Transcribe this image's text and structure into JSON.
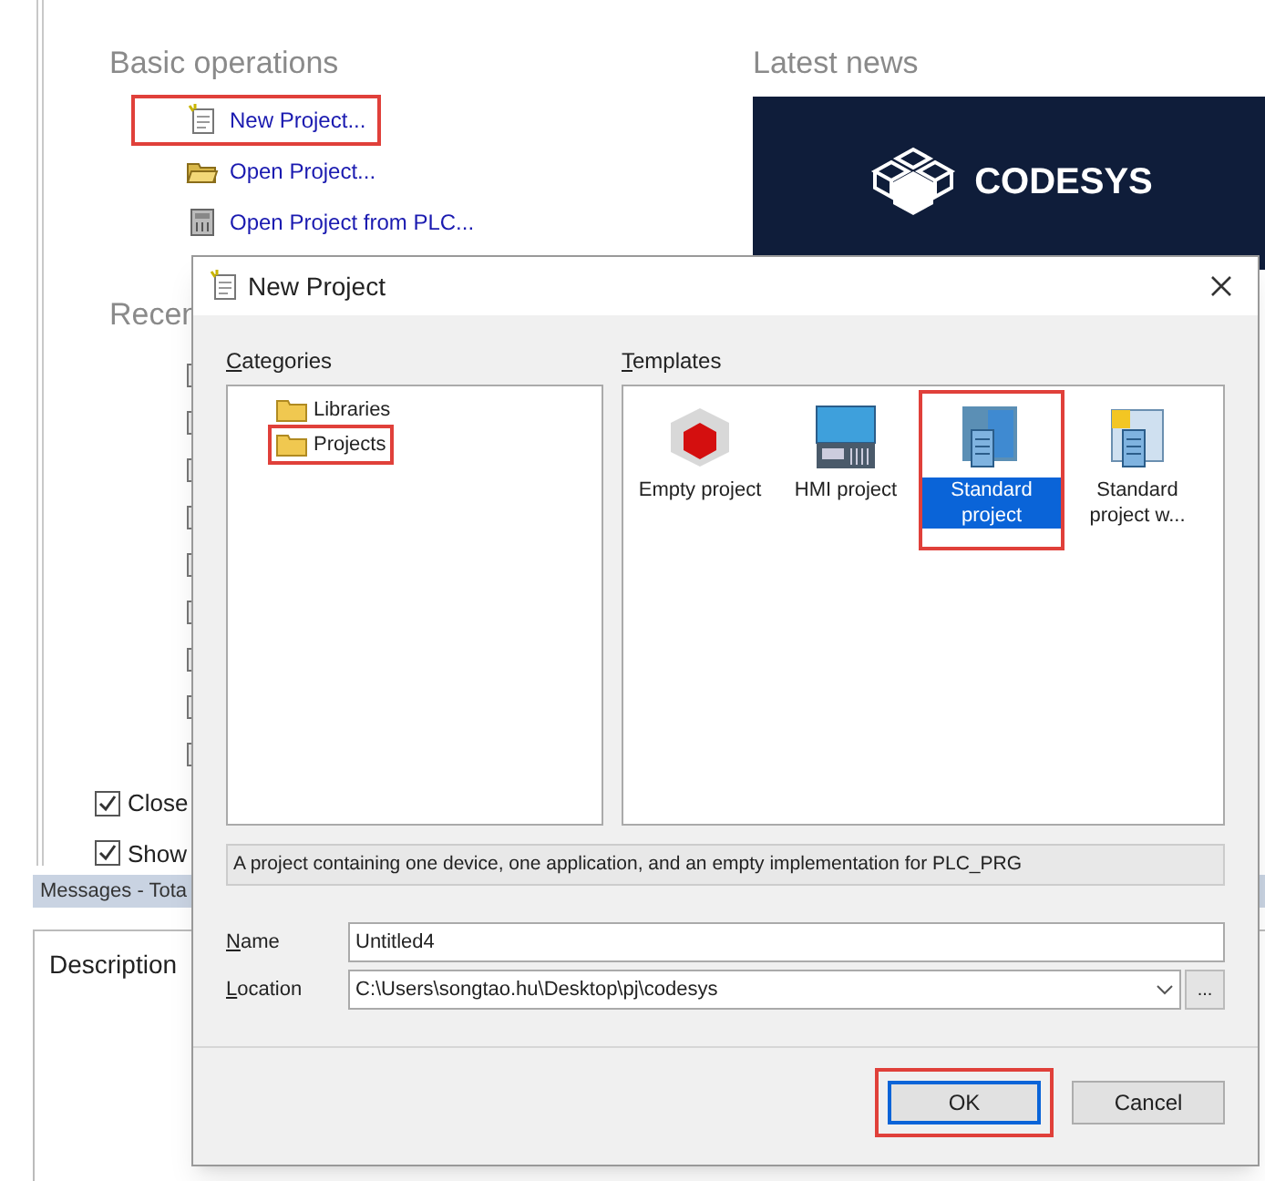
{
  "start_page": {
    "basic_operations": {
      "title": "Basic operations",
      "links": [
        {
          "label": "New Project...",
          "kind": "new",
          "highlighted": true
        },
        {
          "label": "Open Project...",
          "kind": "open",
          "highlighted": false
        },
        {
          "label": "Open Project from PLC...",
          "kind": "plc",
          "highlighted": false
        }
      ]
    },
    "recent": {
      "title": "Recen"
    },
    "options": [
      {
        "label": "Close",
        "checked": true
      },
      {
        "label": "Show",
        "checked": true
      }
    ],
    "latest_news": {
      "title": "Latest news",
      "banner_text": "CODESYS"
    },
    "messages_bar": {
      "title": "Messages - Tota"
    },
    "description_panel": {
      "title": "Description"
    }
  },
  "dialog": {
    "title": "New Project",
    "categories": {
      "label": "Categories",
      "items": [
        {
          "label": "Libraries",
          "selected": false,
          "highlighted": false
        },
        {
          "label": "Projects",
          "selected": false,
          "highlighted": true
        }
      ]
    },
    "templates": {
      "label": "Templates",
      "items": [
        {
          "label": "Empty project",
          "kind": "empty",
          "selected": false,
          "highlighted": false
        },
        {
          "label": "HMI project",
          "kind": "hmi",
          "selected": false,
          "highlighted": false
        },
        {
          "label": "Standard project",
          "kind": "standard",
          "selected": true,
          "highlighted": true
        },
        {
          "label": "Standard project w...",
          "kind": "standard_wizard",
          "selected": false,
          "highlighted": false
        }
      ]
    },
    "template_description": "A project containing one device, one application, and an empty implementation for PLC_PRG",
    "name": {
      "label": "Name",
      "value": "Untitled4"
    },
    "location": {
      "label": "Location",
      "value": "C:\\Users\\songtao.hu\\Desktop\\pj\\codesys",
      "browse": "..."
    },
    "buttons": [
      {
        "label": "OK",
        "default": true,
        "highlighted": true
      },
      {
        "label": "Cancel",
        "default": false,
        "highlighted": false
      }
    ]
  }
}
